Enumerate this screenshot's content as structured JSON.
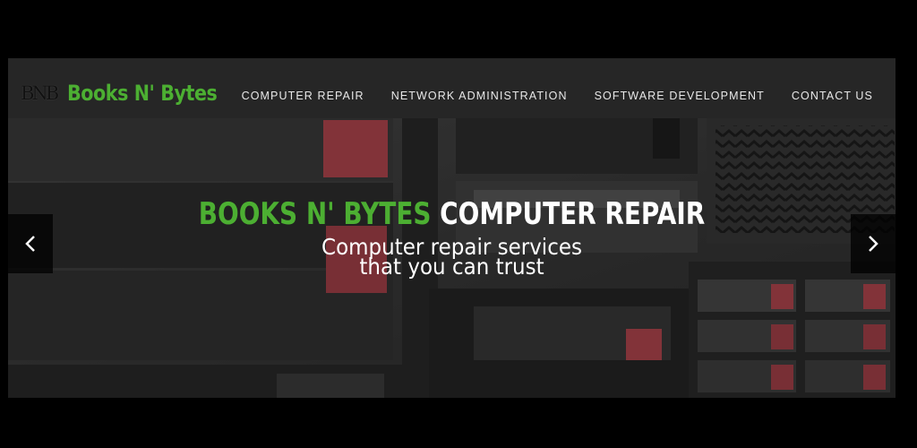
{
  "brand": {
    "mark": "BNB",
    "name": "Books N' Bytes"
  },
  "nav": {
    "items": [
      {
        "label": "COMPUTER REPAIR"
      },
      {
        "label": "NETWORK ADMINISTRATION"
      },
      {
        "label": "SOFTWARE DEVELOPMENT"
      },
      {
        "label": "CONTACT US"
      }
    ]
  },
  "hero": {
    "title_accent": "BOOKS N' BYTES",
    "title_rest": "COMPUTER REPAIR",
    "subtitle_line1": "Computer repair services",
    "subtitle_line2": "that you can trust",
    "prev_icon": "chevron-left-icon",
    "next_icon": "chevron-right-icon"
  },
  "colors": {
    "accent": "#4caf32",
    "header_bg": "#262626",
    "page_bg": "#000000",
    "drive_tab": "#b4474f"
  }
}
